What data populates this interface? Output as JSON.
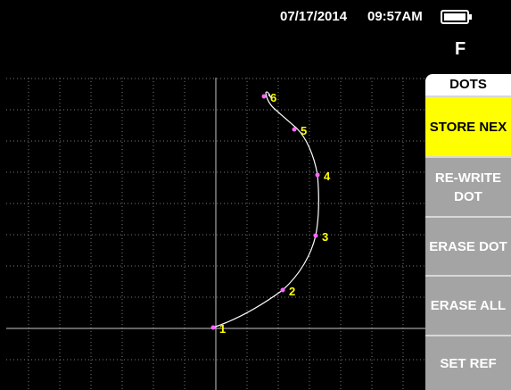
{
  "status_bar": {
    "date": "07/17/2014",
    "time": "09:57AM",
    "battery_icon": "battery-icon",
    "frequency_indicator": "F"
  },
  "menu": {
    "title": "DOTS",
    "buttons": [
      {
        "label": "STORE NEX",
        "state": "selected"
      },
      {
        "label": "RE-WRITE\nDOT",
        "state": "normal"
      },
      {
        "label": "ERASE DOT",
        "state": "normal"
      },
      {
        "label": "ERASE ALL",
        "state": "normal"
      },
      {
        "label": "SET REF",
        "state": "normal"
      }
    ]
  },
  "trace": {
    "dots": [
      {
        "label": "1"
      },
      {
        "label": "2"
      },
      {
        "label": "3"
      },
      {
        "label": "4"
      },
      {
        "label": "5"
      },
      {
        "label": "6"
      }
    ],
    "colors": {
      "background": "#000000",
      "grid": "#7a7a7a",
      "trace": "#ffffff",
      "dot": "#ff66ff",
      "dot_label": "#ffff00",
      "highlight": "#ffff00",
      "button": "#a4a4a4"
    }
  }
}
